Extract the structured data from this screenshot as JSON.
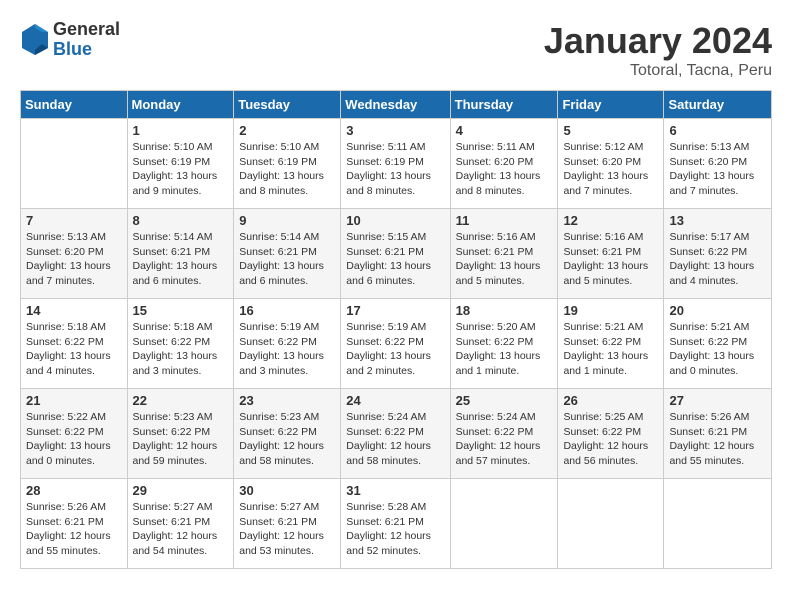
{
  "logo": {
    "general": "General",
    "blue": "Blue"
  },
  "title": "January 2024",
  "location": "Totoral, Tacna, Peru",
  "weekdays": [
    "Sunday",
    "Monday",
    "Tuesday",
    "Wednesday",
    "Thursday",
    "Friday",
    "Saturday"
  ],
  "weeks": [
    [
      {
        "day": "",
        "info": ""
      },
      {
        "day": "1",
        "info": "Sunrise: 5:10 AM\nSunset: 6:19 PM\nDaylight: 13 hours\nand 9 minutes."
      },
      {
        "day": "2",
        "info": "Sunrise: 5:10 AM\nSunset: 6:19 PM\nDaylight: 13 hours\nand 8 minutes."
      },
      {
        "day": "3",
        "info": "Sunrise: 5:11 AM\nSunset: 6:19 PM\nDaylight: 13 hours\nand 8 minutes."
      },
      {
        "day": "4",
        "info": "Sunrise: 5:11 AM\nSunset: 6:20 PM\nDaylight: 13 hours\nand 8 minutes."
      },
      {
        "day": "5",
        "info": "Sunrise: 5:12 AM\nSunset: 6:20 PM\nDaylight: 13 hours\nand 7 minutes."
      },
      {
        "day": "6",
        "info": "Sunrise: 5:13 AM\nSunset: 6:20 PM\nDaylight: 13 hours\nand 7 minutes."
      }
    ],
    [
      {
        "day": "7",
        "info": "Sunrise: 5:13 AM\nSunset: 6:20 PM\nDaylight: 13 hours\nand 7 minutes."
      },
      {
        "day": "8",
        "info": "Sunrise: 5:14 AM\nSunset: 6:21 PM\nDaylight: 13 hours\nand 6 minutes."
      },
      {
        "day": "9",
        "info": "Sunrise: 5:14 AM\nSunset: 6:21 PM\nDaylight: 13 hours\nand 6 minutes."
      },
      {
        "day": "10",
        "info": "Sunrise: 5:15 AM\nSunset: 6:21 PM\nDaylight: 13 hours\nand 6 minutes."
      },
      {
        "day": "11",
        "info": "Sunrise: 5:16 AM\nSunset: 6:21 PM\nDaylight: 13 hours\nand 5 minutes."
      },
      {
        "day": "12",
        "info": "Sunrise: 5:16 AM\nSunset: 6:21 PM\nDaylight: 13 hours\nand 5 minutes."
      },
      {
        "day": "13",
        "info": "Sunrise: 5:17 AM\nSunset: 6:22 PM\nDaylight: 13 hours\nand 4 minutes."
      }
    ],
    [
      {
        "day": "14",
        "info": "Sunrise: 5:18 AM\nSunset: 6:22 PM\nDaylight: 13 hours\nand 4 minutes."
      },
      {
        "day": "15",
        "info": "Sunrise: 5:18 AM\nSunset: 6:22 PM\nDaylight: 13 hours\nand 3 minutes."
      },
      {
        "day": "16",
        "info": "Sunrise: 5:19 AM\nSunset: 6:22 PM\nDaylight: 13 hours\nand 3 minutes."
      },
      {
        "day": "17",
        "info": "Sunrise: 5:19 AM\nSunset: 6:22 PM\nDaylight: 13 hours\nand 2 minutes."
      },
      {
        "day": "18",
        "info": "Sunrise: 5:20 AM\nSunset: 6:22 PM\nDaylight: 13 hours\nand 1 minute."
      },
      {
        "day": "19",
        "info": "Sunrise: 5:21 AM\nSunset: 6:22 PM\nDaylight: 13 hours\nand 1 minute."
      },
      {
        "day": "20",
        "info": "Sunrise: 5:21 AM\nSunset: 6:22 PM\nDaylight: 13 hours\nand 0 minutes."
      }
    ],
    [
      {
        "day": "21",
        "info": "Sunrise: 5:22 AM\nSunset: 6:22 PM\nDaylight: 13 hours\nand 0 minutes."
      },
      {
        "day": "22",
        "info": "Sunrise: 5:23 AM\nSunset: 6:22 PM\nDaylight: 12 hours\nand 59 minutes."
      },
      {
        "day": "23",
        "info": "Sunrise: 5:23 AM\nSunset: 6:22 PM\nDaylight: 12 hours\nand 58 minutes."
      },
      {
        "day": "24",
        "info": "Sunrise: 5:24 AM\nSunset: 6:22 PM\nDaylight: 12 hours\nand 58 minutes."
      },
      {
        "day": "25",
        "info": "Sunrise: 5:24 AM\nSunset: 6:22 PM\nDaylight: 12 hours\nand 57 minutes."
      },
      {
        "day": "26",
        "info": "Sunrise: 5:25 AM\nSunset: 6:22 PM\nDaylight: 12 hours\nand 56 minutes."
      },
      {
        "day": "27",
        "info": "Sunrise: 5:26 AM\nSunset: 6:21 PM\nDaylight: 12 hours\nand 55 minutes."
      }
    ],
    [
      {
        "day": "28",
        "info": "Sunrise: 5:26 AM\nSunset: 6:21 PM\nDaylight: 12 hours\nand 55 minutes."
      },
      {
        "day": "29",
        "info": "Sunrise: 5:27 AM\nSunset: 6:21 PM\nDaylight: 12 hours\nand 54 minutes."
      },
      {
        "day": "30",
        "info": "Sunrise: 5:27 AM\nSunset: 6:21 PM\nDaylight: 12 hours\nand 53 minutes."
      },
      {
        "day": "31",
        "info": "Sunrise: 5:28 AM\nSunset: 6:21 PM\nDaylight: 12 hours\nand 52 minutes."
      },
      {
        "day": "",
        "info": ""
      },
      {
        "day": "",
        "info": ""
      },
      {
        "day": "",
        "info": ""
      }
    ]
  ]
}
